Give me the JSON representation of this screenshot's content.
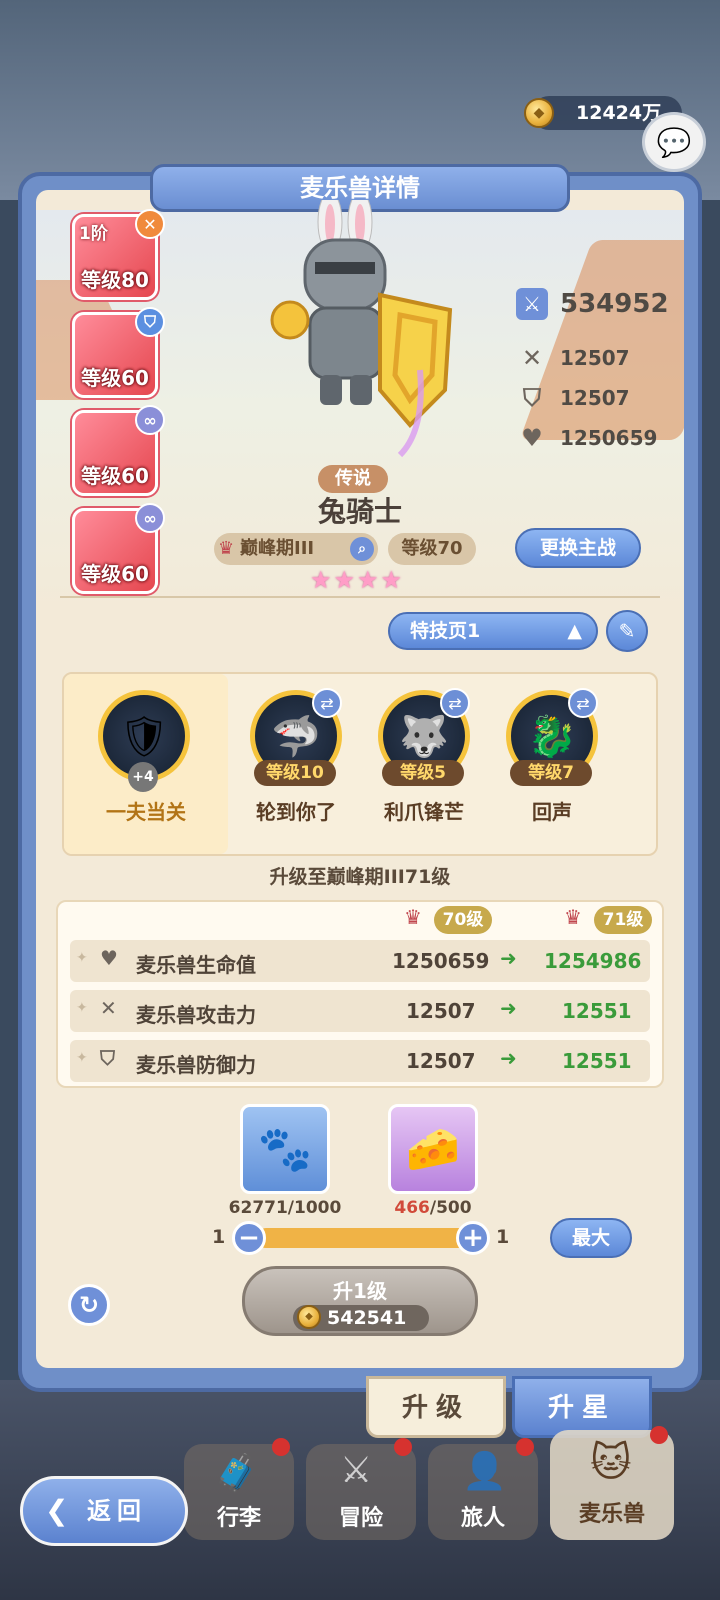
{
  "currency": {
    "amount": "12424万"
  },
  "panel": {
    "title": "麦乐兽详情"
  },
  "skills": [
    {
      "rank": "1阶",
      "level": "等级80",
      "badge": "x"
    },
    {
      "rank": "",
      "level": "等级60",
      "badge": "shield"
    },
    {
      "rank": "",
      "level": "等级60",
      "badge": "link"
    },
    {
      "rank": "",
      "level": "等级60",
      "badge": "link"
    }
  ],
  "stats": {
    "power": "534952",
    "attack": "12507",
    "defense": "12507",
    "hp": "1250659"
  },
  "pet": {
    "rarity": "传说",
    "name": "兔骑士",
    "stage": "巅峰期III",
    "level": "等级70",
    "stars": "★★★★",
    "change_button": "更换主战"
  },
  "trait_page": {
    "label": "特技页1"
  },
  "traits": [
    {
      "name": "一夫当关",
      "level": "+4"
    },
    {
      "name": "轮到你了",
      "level": "等级10"
    },
    {
      "name": "利爪锋芒",
      "level": "等级5"
    },
    {
      "name": "回声",
      "level": "等级7"
    }
  ],
  "upgrade": {
    "title": "升级至巅峰期III71级",
    "from_level": "70级",
    "to_level": "71级",
    "rows": [
      {
        "label": "麦乐兽生命值",
        "from": "1250659",
        "to": "1254986"
      },
      {
        "label": "麦乐兽攻击力",
        "from": "12507",
        "to": "12551"
      },
      {
        "label": "麦乐兽防御力",
        "from": "12507",
        "to": "12551"
      }
    ]
  },
  "materials": [
    {
      "count": "62771/1000",
      "icon": "pet-food-bag-icon"
    },
    {
      "have": "466",
      "need": "/500",
      "icon": "cheese-icon"
    }
  ],
  "quantity": {
    "min": "1",
    "max": "1",
    "max_button": "最大"
  },
  "level_up_button": {
    "label": "升1级",
    "cost": "542541"
  },
  "tabs": {
    "upgrade": "升级",
    "star": "升星"
  },
  "nav": {
    "back": "返回",
    "items": [
      "行李",
      "冒险",
      "旅人",
      "麦乐兽"
    ]
  },
  "colors": {
    "accent_blue": "#6f8fc8",
    "gain_green": "#3a9b3a",
    "warn_red": "#d14a3a"
  }
}
